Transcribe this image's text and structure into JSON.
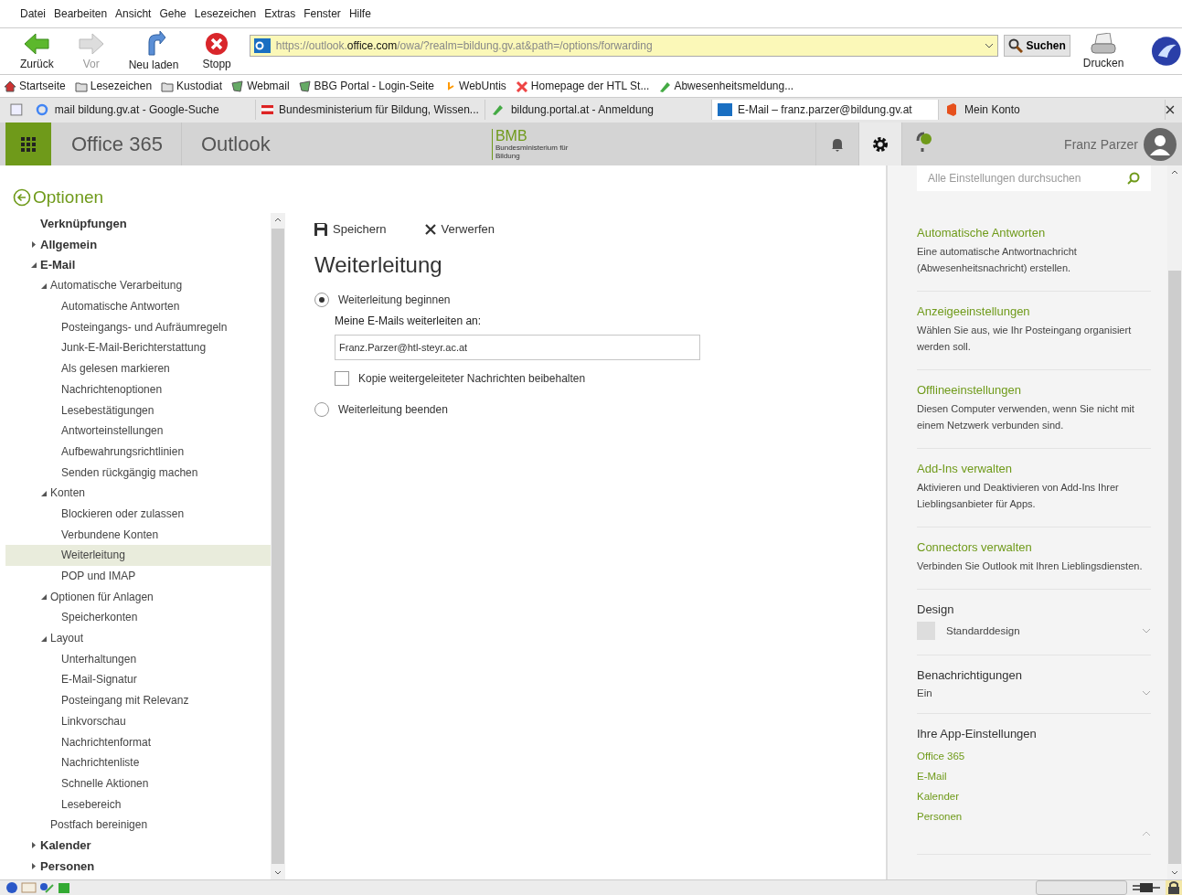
{
  "menu": [
    "Datei",
    "Bearbeiten",
    "Ansicht",
    "Gehe",
    "Lesezeichen",
    "Extras",
    "Fenster",
    "Hilfe"
  ],
  "toolbar": {
    "buttons": [
      {
        "kind": "back",
        "label": "Zurück",
        "disabled": false
      },
      {
        "kind": "forward",
        "label": "Vor",
        "disabled": true
      },
      {
        "kind": "reload",
        "label": "Neu laden",
        "disabled": false
      },
      {
        "kind": "stop",
        "label": "Stopp",
        "disabled": false
      }
    ],
    "url": "https://outlook.**office.com**/owa/?realm=bildung.gv.at&path=/options/forwarding",
    "search_button": "Suchen",
    "print_button": "Drucken"
  },
  "bookmarks": [
    {
      "kind": "home",
      "label": "Startseite"
    },
    {
      "kind": "folder",
      "label": "Lesezeichen"
    },
    {
      "kind": "folder",
      "label": "Kustodiat"
    },
    {
      "kind": "mail",
      "label": "Webmail"
    },
    {
      "kind": "page",
      "label": "BBG Portal - Login-Seite"
    },
    {
      "kind": "untis",
      "label": "WebUntis"
    },
    {
      "kind": "joomla",
      "label": "Homepage der HTL St..."
    },
    {
      "kind": "pin",
      "label": "Abwesenheitsmeldung..."
    }
  ],
  "tabs": [
    {
      "kind": "google",
      "label": "mail bildung.gv.at - Google-Suche",
      "selected": false
    },
    {
      "kind": "flag",
      "label": "Bundesministerium für Bildung, Wissen...",
      "selected": false
    },
    {
      "kind": "pin",
      "label": "bildung.portal.at - Anmeldung",
      "selected": false
    },
    {
      "kind": "outlook",
      "label": "E-Mail – franz.parzer@bildung.gv.at",
      "selected": true
    },
    {
      "kind": "office",
      "label": "Mein Konto",
      "selected": false
    }
  ],
  "header": {
    "suite": "Office 365",
    "app": "Outlook",
    "logo": "BMB",
    "logo_sub": "Bundesministerium für Bildung",
    "user": "Franz Parzer",
    "icons": [
      {
        "kind": "bell",
        "selected": false
      },
      {
        "kind": "gear",
        "selected": true
      },
      {
        "kind": "help",
        "selected": false
      }
    ]
  },
  "options_title": "Optionen",
  "nav": [
    {
      "label": "Verknüpfungen",
      "selected": false
    },
    {
      "label": "Allgemein",
      "expanded": false,
      "selected": false
    },
    {
      "label": "E-Mail",
      "expanded": true,
      "selected": false,
      "children": [
        {
          "label": "Automatische Verarbeitung",
          "expanded": true,
          "selected": false,
          "children": [
            {
              "label": "Automatische Antworten",
              "selected": false
            },
            {
              "label": "Posteingangs- und Aufräumregeln",
              "selected": false
            },
            {
              "label": "Junk-E-Mail-Berichterstattung",
              "selected": false
            },
            {
              "label": "Als gelesen markieren",
              "selected": false
            },
            {
              "label": "Nachrichtenoptionen",
              "selected": false
            },
            {
              "label": "Lesebestätigungen",
              "selected": false
            },
            {
              "label": "Antworteinstellungen",
              "selected": false
            },
            {
              "label": "Aufbewahrungsrichtlinien",
              "selected": false
            },
            {
              "label": "Senden rückgängig machen",
              "selected": false
            }
          ]
        },
        {
          "label": "Konten",
          "expanded": true,
          "selected": false,
          "children": [
            {
              "label": "Blockieren oder zulassen",
              "selected": false
            },
            {
              "label": "Verbundene Konten",
              "selected": false
            },
            {
              "label": "Weiterleitung",
              "selected": true
            },
            {
              "label": "POP und IMAP",
              "selected": false
            }
          ]
        },
        {
          "label": "Optionen für Anlagen",
          "expanded": true,
          "selected": false,
          "children": [
            {
              "label": "Speicherkonten",
              "selected": false
            }
          ]
        },
        {
          "label": "Layout",
          "expanded": true,
          "selected": false,
          "children": [
            {
              "label": "Unterhaltungen",
              "selected": false
            },
            {
              "label": "E-Mail-Signatur",
              "selected": false
            },
            {
              "label": "Posteingang mit Relevanz",
              "selected": false
            },
            {
              "label": "Linkvorschau",
              "selected": false
            },
            {
              "label": "Nachrichtenformat",
              "selected": false
            },
            {
              "label": "Nachrichtenliste",
              "selected": false
            },
            {
              "label": "Schnelle Aktionen",
              "selected": false
            },
            {
              "label": "Lesebereich",
              "selected": false
            }
          ]
        },
        {
          "label": "Postfach bereinigen",
          "selected": false
        }
      ]
    },
    {
      "label": "Kalender",
      "expanded": false,
      "selected": false
    },
    {
      "label": "Personen",
      "expanded": false,
      "selected": false
    }
  ],
  "actions": {
    "save": "Speichern",
    "discard": "Verwerfen"
  },
  "form": {
    "title": "Weiterleitung",
    "start": {
      "label": "Weiterleitung beginnen",
      "selected": true
    },
    "address_label": "Meine E-Mails weiterleiten an:",
    "address": "Franz.Parzer@htl-steyr.ac.at",
    "keep_copy": {
      "label": "Kopie weitergeleiteter Nachrichten beibehalten",
      "checked": false
    },
    "stop": {
      "label": "Weiterleitung beenden",
      "selected": false
    }
  },
  "panel": {
    "search_placeholder": "Alle Einstellungen durchsuchen",
    "links": [
      {
        "title": "Automatische Antworten",
        "text": "Eine automatische Antwortnachricht (Abwesenheitsnachricht) erstellen."
      },
      {
        "title": "Anzeigeeinstellungen",
        "text": "Wählen Sie aus, wie Ihr Posteingang organisiert werden soll."
      },
      {
        "title": "Offlineeinstellungen",
        "text": "Diesen Computer verwenden, wenn Sie nicht mit einem Netzwerk verbunden sind."
      },
      {
        "title": "Add-Ins verwalten",
        "text": "Aktivieren und Deaktivieren von Add-Ins Ihrer Lieblingsanbieter für Apps."
      },
      {
        "title": "Connectors verwalten",
        "text": "Verbinden Sie Outlook mit Ihren Lieblingsdiensten."
      }
    ],
    "design": {
      "title": "Design",
      "value": "Standarddesign"
    },
    "notifications": {
      "title": "Benachrichtigungen",
      "value": "Ein"
    },
    "apps": {
      "title": "Ihre App-Einstellungen",
      "items": [
        "Office 365",
        "E-Mail",
        "Kalender",
        "Personen"
      ]
    }
  }
}
